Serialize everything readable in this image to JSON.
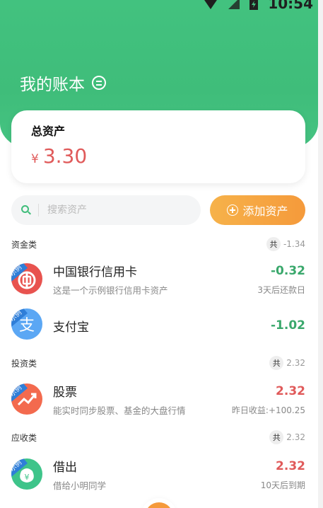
{
  "status_bar": {
    "time": "10:54"
  },
  "header": {
    "title": "我的账本"
  },
  "total_assets": {
    "label": "总资产",
    "currency": "¥",
    "amount": "3.30"
  },
  "search": {
    "placeholder": "搜索资产"
  },
  "add_button": {
    "label": "添加资产"
  },
  "sections": [
    {
      "title": "资金类",
      "total_prefix": "共",
      "total": "-1.34",
      "items": [
        {
          "name": "中国银行信用卡",
          "desc": "这是一个示例银行信用卡资产",
          "value": "-0.32",
          "sub": "3天后还款日",
          "badge": "示例",
          "icon": "bank-of-china-icon",
          "color": "#e8534f"
        },
        {
          "name": "支付宝",
          "desc": "",
          "value": "-1.02",
          "sub": "",
          "badge": "示例",
          "icon": "alipay-icon",
          "color": "#5ba7f4"
        }
      ]
    },
    {
      "title": "投资类",
      "total_prefix": "共",
      "total": "2.32",
      "items": [
        {
          "name": "股票",
          "desc": "能实时同步股票、基金的大盘行情",
          "value": "2.32",
          "sub": "昨日收益:+100.25",
          "badge": "示例",
          "icon": "stock-chart-icon",
          "color": "#f36a4e"
        }
      ]
    },
    {
      "title": "应收类",
      "total_prefix": "共",
      "total": "2.32",
      "items": [
        {
          "name": "借出",
          "desc": "借给小明同学",
          "value": "2.32",
          "sub": "10天后到期",
          "badge": "示例",
          "icon": "money-bag-icon",
          "color": "#3ec48a"
        }
      ]
    }
  ]
}
